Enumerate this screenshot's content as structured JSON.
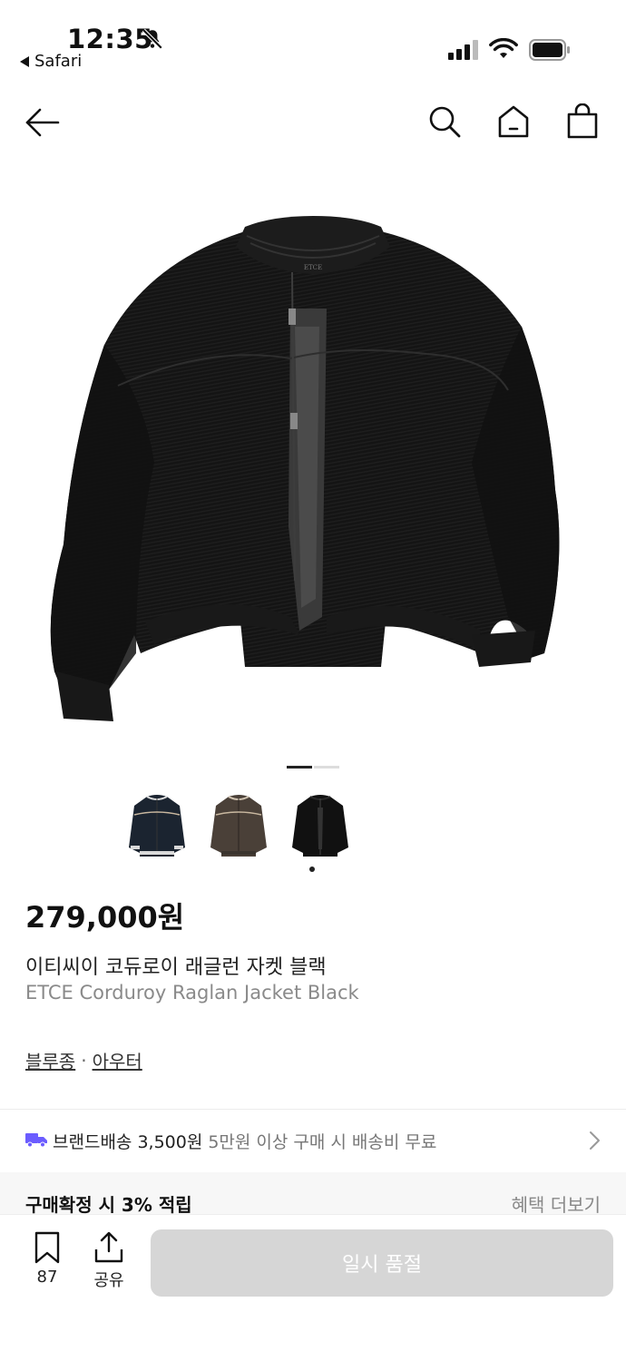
{
  "status_bar": {
    "time": "12:35",
    "back_app": "Safari"
  },
  "nav": {
    "icons": [
      "back-arrow-icon",
      "search-icon",
      "home-icon",
      "shopping-bag-icon"
    ]
  },
  "gallery": {
    "page_index": 1,
    "page_count": 2,
    "thumbnails": [
      {
        "name": "navy-jacket-thumb",
        "color": "#1b2430"
      },
      {
        "name": "brown-jacket-thumb",
        "color": "#4a4038"
      },
      {
        "name": "black-jacket-thumb",
        "color": "#111111"
      }
    ],
    "selected_thumbnail": 2
  },
  "product": {
    "price": "279,000원",
    "name_ko": "이티씨이 코듀로이 래글런 자켓 블랙",
    "name_en": "ETCE Corduroy Raglan Jacket Black",
    "categories": [
      "블루종",
      "아우터"
    ],
    "category_separator": "·"
  },
  "shipping": {
    "label": "브랜드배송 3,500원",
    "sub": "5만원 이상 구매 시 배송비 무료"
  },
  "points": {
    "label": "구매확정 시 3% 적립",
    "more": "혜택 더보기"
  },
  "bottom_bar": {
    "bookmark_count": "87",
    "share_label": "공유",
    "cta_label": "일시 품절"
  },
  "colors": {
    "accent_truck": "#6b5cff",
    "cta_disabled": "#d6d6d6"
  }
}
